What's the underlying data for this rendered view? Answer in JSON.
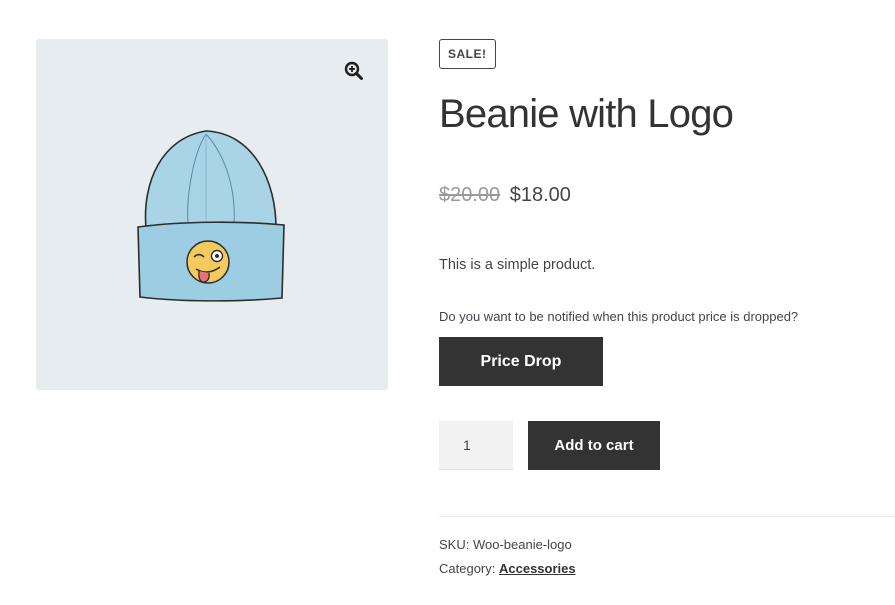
{
  "product": {
    "sale_badge": "SALE!",
    "title": "Beanie with Logo",
    "price_old": "$20.00",
    "price_new": "$18.00",
    "description": "This is a simple product.",
    "notify_text": "Do you want to be notified when this product price is dropped?",
    "price_drop_label": "Price Drop",
    "quantity_value": "1",
    "add_to_cart_label": "Add to cart",
    "sku_label": "SKU: ",
    "sku_value": "Woo-beanie-logo",
    "category_label": "Category: ",
    "category_value": "Accessories"
  },
  "gallery": {
    "zoom_icon": "magnifier-plus-icon",
    "image": "beanie-with-wink-emoji-logo"
  },
  "colors": {
    "button_bg": "#333333",
    "gallery_bg": "#e6ecf0",
    "beanie_blue": "#a8d4e6",
    "emoji_yellow": "#f4c95d"
  }
}
